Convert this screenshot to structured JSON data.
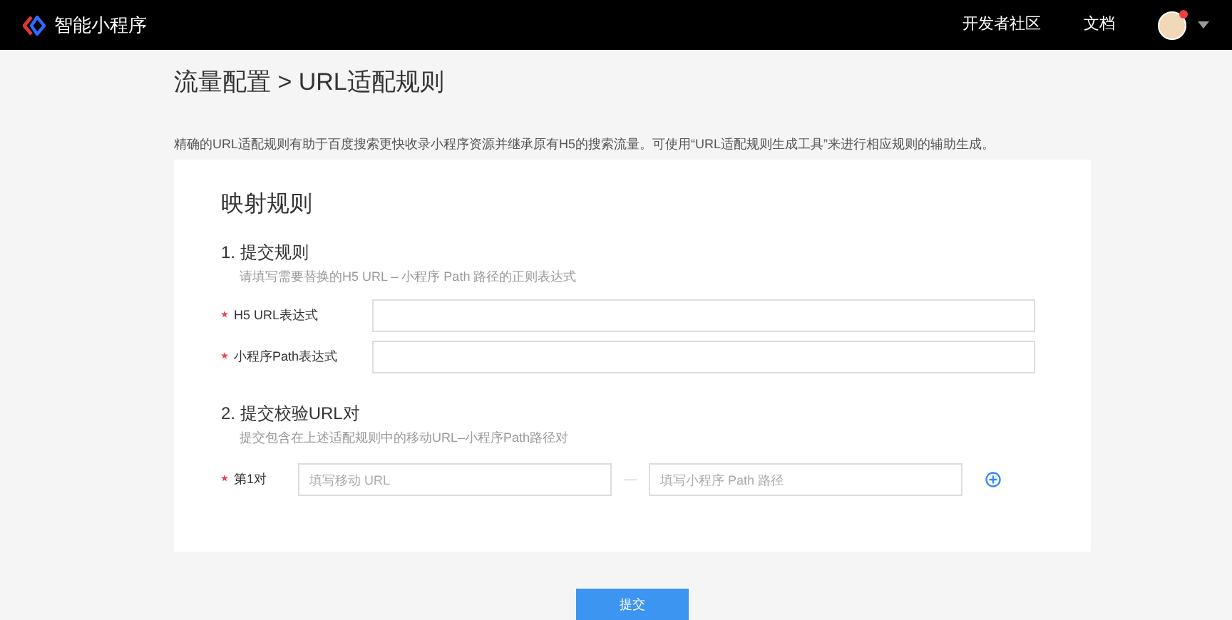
{
  "header": {
    "app_name": "智能小程序",
    "links": [
      "开发者社区",
      "文档"
    ],
    "notification": true
  },
  "page": {
    "title": "流量配置 > URL适配规则",
    "description": "精确的URL适配规则有助于百度搜索更快收录小程序资源并继承原有H5的搜索流量。可使用“URL适配规则生成工具”来进行相应规则的辅助生成。"
  },
  "card": {
    "title": "映射规则",
    "section_1": {
      "title": "1. 提交规则",
      "hint": "请填写需要替换的H5 URL – 小程序 Path 路径的正则表达式",
      "fields": [
        {
          "label": "H5 URL表达式",
          "required": true
        },
        {
          "label": "小程序Path表达式",
          "required": true
        }
      ]
    },
    "section_2": {
      "title": "2. 提交校验URL对",
      "hint": "提交包含在上述适配规则中的移动URL–小程序Path路径对",
      "pairs": [
        {
          "label": "第1对",
          "required": true,
          "url_placeholder": "填写移动 URL",
          "separator": "—",
          "path_placeholder": "填写小程序 Path 路径"
        }
      ]
    }
  },
  "submit_button": "提交"
}
